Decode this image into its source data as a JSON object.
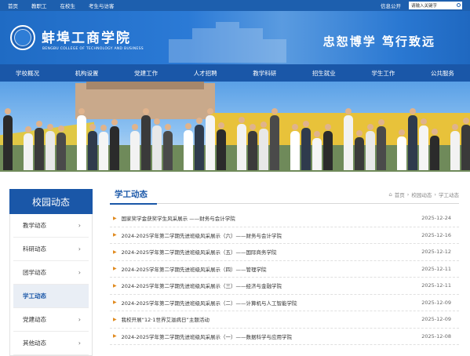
{
  "topbar": {
    "links": [
      "首页",
      "教职工",
      "在校生",
      "考生与访客"
    ],
    "info": "信息公开",
    "search_placeholder": "请输入关键字"
  },
  "header": {
    "school_name": "蚌埠工商学院",
    "school_en": "BENGBU COLLEGE OF TECHNOLOGY AND BUSINESS",
    "motto": "忠恕博学  笃行致远"
  },
  "nav": [
    "学校概况",
    "机构设置",
    "党建工作",
    "人才招聘",
    "教学科研",
    "招生就业",
    "学生工作",
    "公共服务"
  ],
  "sidebar": {
    "title": "校园动态",
    "items": [
      {
        "label": "教学动态"
      },
      {
        "label": "科研动态"
      },
      {
        "label": "团学动态"
      },
      {
        "label": "学工动态"
      },
      {
        "label": "党建动态"
      },
      {
        "label": "其他动态"
      }
    ],
    "active_index": 3
  },
  "content": {
    "title": "学工动态",
    "breadcrumb": [
      "首页",
      "校园动态",
      "学工动态"
    ],
    "news": [
      {
        "title": "国家奖学金获奖学生风采展示 ——财务与会计学院",
        "date": "2025-12-24"
      },
      {
        "title": "2024-2025学年第二学期先进班级风采展示（六）——财务与会计学院",
        "date": "2025-12-16"
      },
      {
        "title": "2024-2025学年第二学期先进班级风采展示（五）——国际商务学院",
        "date": "2025-12-12"
      },
      {
        "title": "2024-2025学年第二学期先进班级风采展示（四）——管理学院",
        "date": "2025-12-11"
      },
      {
        "title": "2024-2025学年第二学期先进班级风采展示（三）——经济与金融学院",
        "date": "2025-12-11"
      },
      {
        "title": "2024-2025学年第二学期先进班级风采展示（二）——计算机与人工智能学院",
        "date": "2025-12-09"
      },
      {
        "title": "我校开展“12·1世界艾滋病日”主题活动",
        "date": "2025-12-09"
      },
      {
        "title": "2024-2025学年第二学期先进班级风采展示（一）——数据科学与应用学院",
        "date": "2025-12-08"
      }
    ]
  },
  "colors": {
    "brand": "#1a57a8",
    "accent": "#e08a1e"
  },
  "icons": [
    "home-icon",
    "search-icon",
    "chevron-right-icon",
    "triangle-bullet-icon"
  ]
}
